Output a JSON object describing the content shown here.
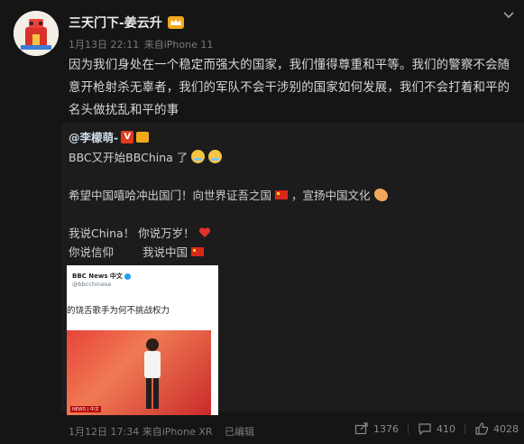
{
  "post": {
    "author": "三天门下-姜云升",
    "date": "1月13日 22:11",
    "source": "来自iPhone 11",
    "text": "因为我们身处在一个稳定而强大的国家，我们懂得尊重和平等。我们的警察不会随意开枪射杀无辜者，我们的军队不会干涉别的国家如何发展，我们不会打着和平的名头做扰乱和平的事"
  },
  "repost": {
    "user": "@李檬萌-",
    "line1": "BBC又开始BBChina 了",
    "line2": "希望中国嘻哈冲出国门！向世界证吾之国",
    "line2b": "，宣扬中国文化",
    "line3": "我说China！ 你说万岁！",
    "line4a": "你说信仰",
    "line4b": "我说中国",
    "image": {
      "account": "BBC News 中文",
      "handle": "@bbcchinese",
      "headline": "的饶舌歌手为何不挑战权力",
      "tag": "NEWS | 中文"
    }
  },
  "footer": {
    "date": "1月12日 17:34",
    "source": "来自iPhone XR",
    "edited": "已编辑",
    "reposts": "1376",
    "comments": "410",
    "likes": "4028"
  }
}
